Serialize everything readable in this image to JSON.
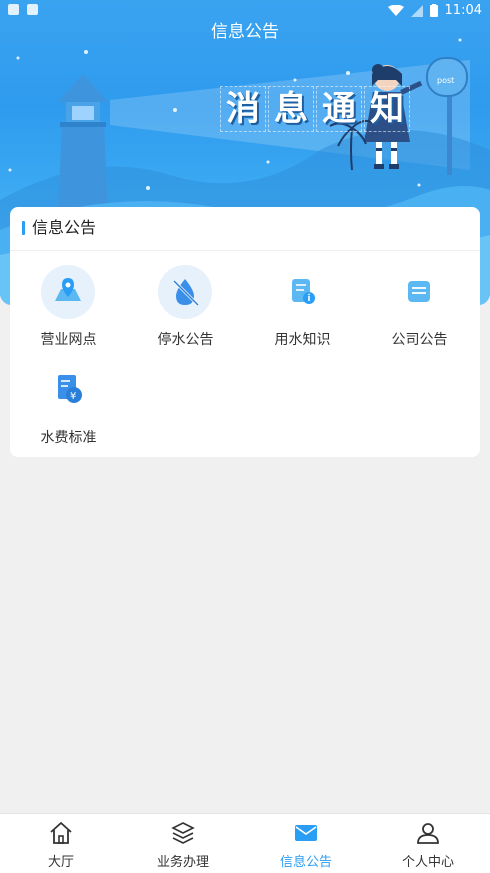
{
  "status_bar": {
    "time": "11:04"
  },
  "header": {
    "title": "信息公告"
  },
  "banner": {
    "headline": [
      "消",
      "息",
      "通",
      "知"
    ],
    "mailbox_text": "post"
  },
  "section": {
    "title": "信息公告",
    "items": [
      {
        "label": "营业网点",
        "icon": "map-pin-icon"
      },
      {
        "label": "停水公告",
        "icon": "water-drop-off-icon"
      },
      {
        "label": "用水知识",
        "icon": "document-info-icon"
      },
      {
        "label": "公司公告",
        "icon": "notice-card-icon"
      },
      {
        "label": "水费标准",
        "icon": "bill-yen-icon"
      }
    ]
  },
  "tabbar": {
    "active_color": "#2a9df4",
    "tabs": [
      {
        "label": "大厅",
        "icon": "home-icon"
      },
      {
        "label": "业务办理",
        "icon": "layers-icon"
      },
      {
        "label": "信息公告",
        "icon": "mail-icon",
        "active": true
      },
      {
        "label": "个人中心",
        "icon": "user-icon"
      }
    ]
  }
}
